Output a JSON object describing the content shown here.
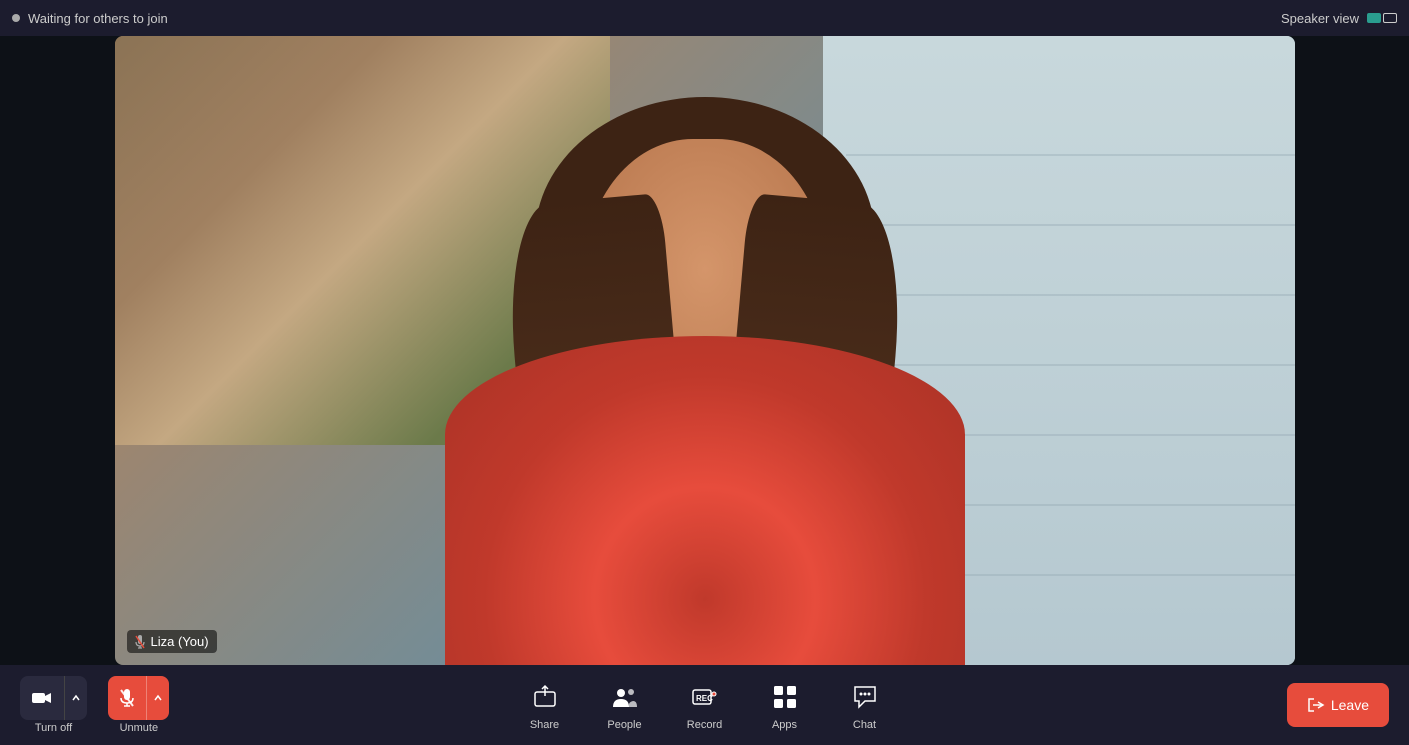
{
  "topBar": {
    "waitingText": "Waiting for others to join",
    "speakerViewLabel": "Speaker view",
    "colors": {
      "accent": "#2a9d8f",
      "bg": "#1c1c2e",
      "red": "#e74c3c"
    }
  },
  "video": {
    "participantName": "Liza (You)"
  },
  "toolbar": {
    "camera": {
      "label": "Turn off"
    },
    "mic": {
      "label": "Unmute"
    },
    "share": {
      "label": "Share"
    },
    "record": {
      "label": "Record"
    },
    "people": {
      "label": "People"
    },
    "apps": {
      "label": "Apps"
    },
    "chat": {
      "label": "Chat"
    },
    "leave": {
      "label": "Leave"
    }
  }
}
